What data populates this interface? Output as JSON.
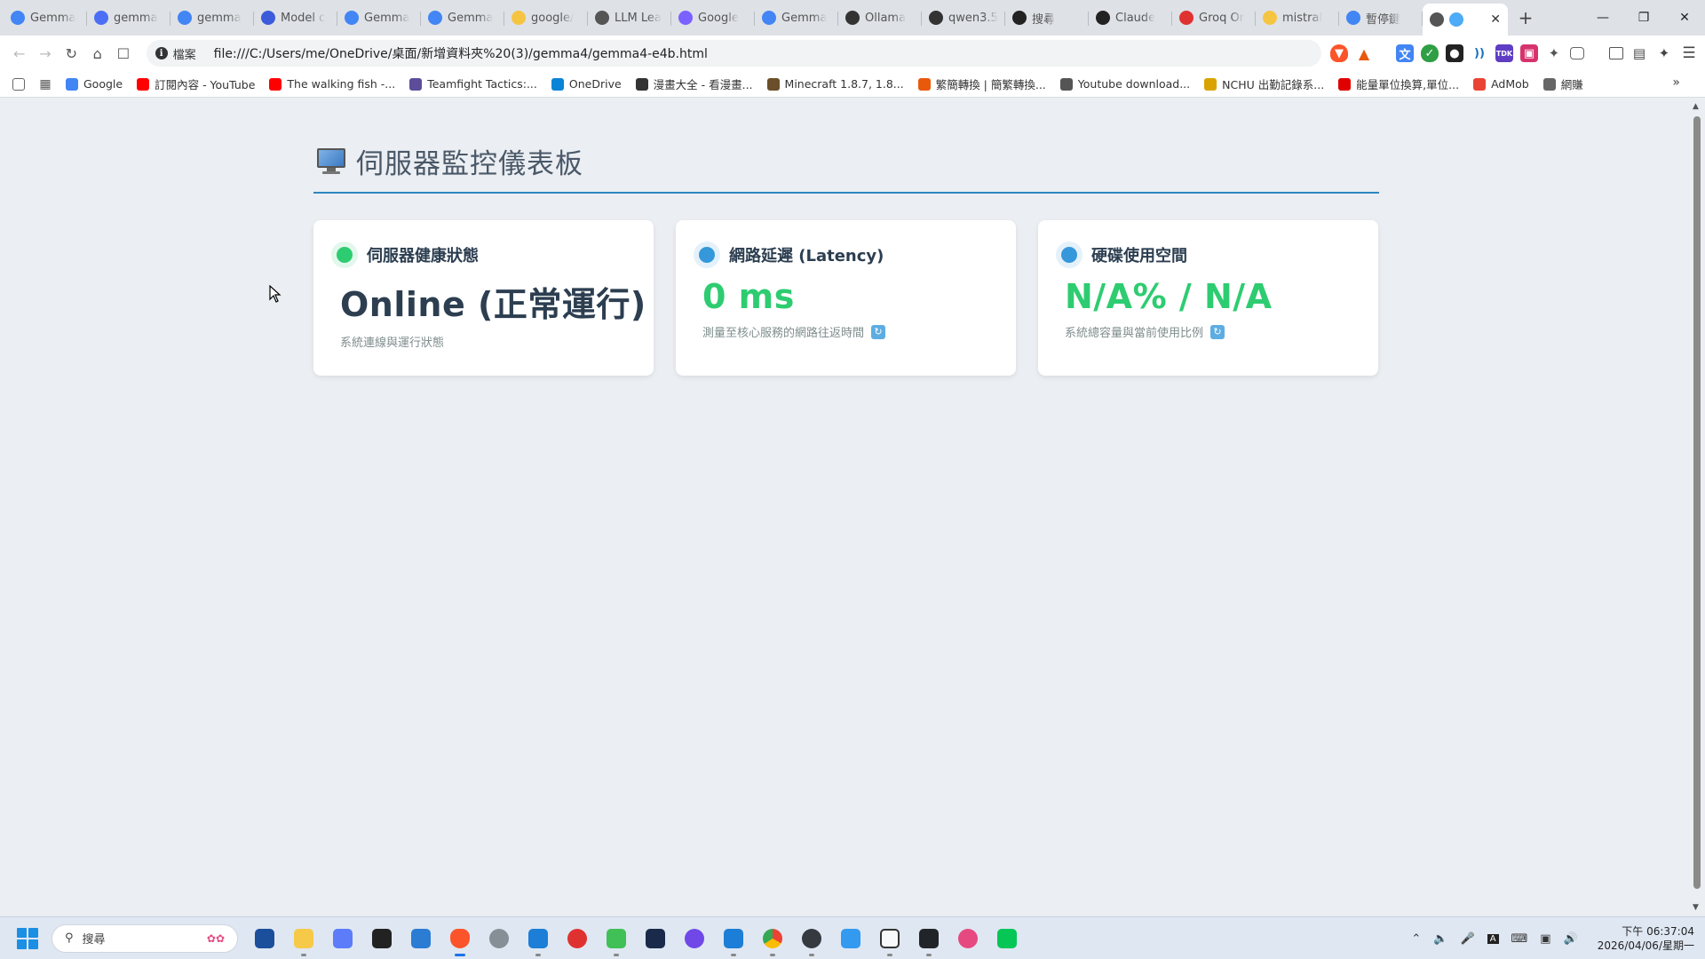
{
  "browser": {
    "tabs": [
      {
        "label": "Gemma",
        "icon": "google-icon",
        "color": "#4285f4"
      },
      {
        "label": "gemma",
        "icon": "gemini-icon",
        "color": "#4c6ef5"
      },
      {
        "label": "gemma",
        "icon": "google-icon",
        "color": "#4285f4"
      },
      {
        "label": "Model c",
        "icon": "model-icon",
        "color": "#3b5bdb"
      },
      {
        "label": "Gemma",
        "icon": "google-icon",
        "color": "#4285f4"
      },
      {
        "label": "Gemma",
        "icon": "google-icon",
        "color": "#4285f4"
      },
      {
        "label": "google/",
        "icon": "huggingface-icon",
        "color": "#f5c542"
      },
      {
        "label": "LLM Lea",
        "icon": "leaderboard-icon",
        "color": "#555555"
      },
      {
        "label": "Google",
        "icon": "sparkle-icon",
        "color": "#7b61ff"
      },
      {
        "label": "Gemma",
        "icon": "google-icon",
        "color": "#4285f4"
      },
      {
        "label": "Ollama",
        "icon": "ollama-icon",
        "color": "#333333"
      },
      {
        "label": "qwen3.5",
        "icon": "ollama-icon",
        "color": "#333333"
      },
      {
        "label": "搜尋",
        "icon": "search-site-icon",
        "color": "#222222"
      },
      {
        "label": "Claude",
        "icon": "claude-icon",
        "color": "#222222"
      },
      {
        "label": "Groq Or",
        "icon": "groq-icon",
        "color": "#e03131"
      },
      {
        "label": "mistral",
        "icon": "huggingface-icon",
        "color": "#f5c542"
      },
      {
        "label": "暫停鍵",
        "icon": "google-icon",
        "color": "#4285f4"
      }
    ],
    "active_tab": {
      "label": "",
      "icon": "globe-icon"
    },
    "new_tab": "+",
    "omnibox": {
      "scheme_label": "檔案",
      "url": "file:///C:/Users/me/OneDrive/桌面/新增資料夾%20(3)/gemma4/gemma4-e4b.html"
    },
    "bookmarks": [
      {
        "label": "Google",
        "color": "#4285f4"
      },
      {
        "label": "訂閱內容 - YouTube",
        "color": "#ff0000"
      },
      {
        "label": "The walking fish -...",
        "color": "#ff0000"
      },
      {
        "label": "Teamfight Tactics:...",
        "color": "#5c4d9a"
      },
      {
        "label": "OneDrive",
        "color": "#0a84d6"
      },
      {
        "label": "漫畫大全 - 看漫畫...",
        "color": "#333333"
      },
      {
        "label": "Minecraft 1.8.7, 1.8...",
        "color": "#6b4f2a"
      },
      {
        "label": "繁簡轉換 | 簡繁轉換...",
        "color": "#e8590c"
      },
      {
        "label": "Youtube download...",
        "color": "#555555"
      },
      {
        "label": "NCHU 出勤記錄系...",
        "color": "#d9a400"
      },
      {
        "label": "能量單位換算,單位...",
        "color": "#e00000"
      },
      {
        "label": "AdMob",
        "color": "#ea4335"
      },
      {
        "label": "網賺",
        "color": "#666666"
      }
    ]
  },
  "dashboard": {
    "title": "伺服器監控儀表板",
    "cards": [
      {
        "title": "伺服器健康狀態",
        "value": "Online (正常運行)",
        "description": "系統連線與運行狀態",
        "dot_color": "#2ecc71",
        "value_color": "#2c3e50",
        "has_refresh": false
      },
      {
        "title": "網路延遲 (Latency)",
        "value": "0 ms",
        "description": "測量至核心服務的網路往返時間",
        "dot_color": "#3498db",
        "value_color": "#2ecc71",
        "has_refresh": true
      },
      {
        "title": "硬碟使用空間",
        "value": "N/A% / N/A",
        "description": "系統總容量與當前使用比例",
        "dot_color": "#3498db",
        "value_color": "#2ecc71",
        "has_refresh": true
      }
    ]
  },
  "taskbar": {
    "search_placeholder": "搜尋",
    "clock_time": "下午 06:37:04",
    "clock_date": "2026/04/06/星期一"
  },
  "colors": {
    "accent": "#2e86c1",
    "page_bg": "#ebeef2"
  }
}
